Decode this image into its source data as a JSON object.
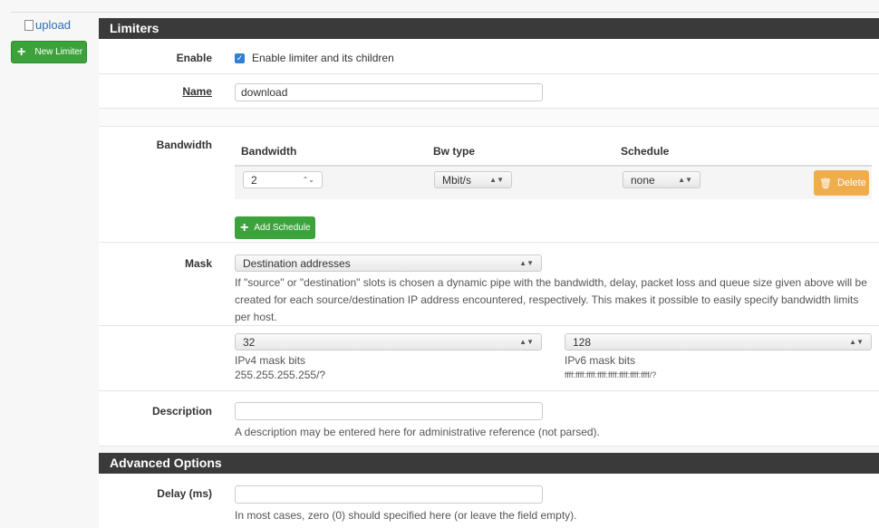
{
  "sidebar": {
    "link": "upload",
    "new_button": "New Limiter"
  },
  "limiters": {
    "title": "Limiters",
    "enable": {
      "label": "Enable",
      "checkbox_label": "Enable limiter and its children",
      "checked": true
    },
    "name": {
      "label": "Name",
      "value": "download"
    },
    "bandwidth": {
      "label": "Bandwidth",
      "headers": [
        "Bandwidth",
        "Bw type",
        "Schedule"
      ],
      "value": "2",
      "bw_type": "Mbit/s",
      "schedule": "none",
      "delete": "Delete",
      "add_schedule": "Add Schedule"
    },
    "mask": {
      "label": "Mask",
      "value": "Destination addresses",
      "help": "If \"source\" or \"destination\" slots is chosen a dynamic pipe with the bandwidth, delay, packet loss and queue size given above will be created for each source/destination IP address encountered, respectively. This makes it possible to easily specify bandwidth limits per host.",
      "ipv4_value": "32",
      "ipv4_label": "IPv4 mask bits",
      "ipv4_hint": "255.255.255.255/?",
      "ipv6_value": "128",
      "ipv6_label": "IPv6 mask bits",
      "ipv6_hint": "ffff:ffff:ffff:ffff:ffff:ffff:ffff:ffff/?"
    },
    "description": {
      "label": "Description",
      "value": "",
      "help": "A description may be entered here for administrative reference (not parsed)."
    }
  },
  "advanced": {
    "title": "Advanced Options",
    "delay": {
      "label": "Delay (ms)",
      "value": "",
      "help": "In most cases, zero (0) should specified here (or leave the field empty)."
    }
  },
  "colors": {
    "green": "#3ca33c",
    "orange": "#f0ad4e",
    "header": "#3a3a3a",
    "link": "#2f6fb3"
  }
}
